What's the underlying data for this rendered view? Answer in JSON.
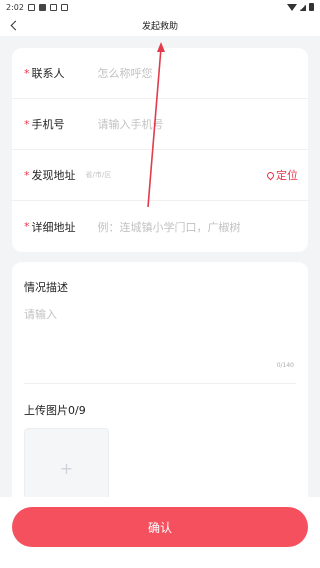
{
  "status_bar": {
    "time": "2:02"
  },
  "nav": {
    "title": "发起救助"
  },
  "form": {
    "contact": {
      "required_mark": "*",
      "label": "联系人",
      "placeholder": "怎么称呼您"
    },
    "phone": {
      "required_mark": "*",
      "label": "手机号",
      "placeholder": "请输入手机号"
    },
    "found_address": {
      "required_mark": "*",
      "label": "发现地址",
      "placeholder": "省/市/区",
      "locate_label": "定位"
    },
    "detail_address": {
      "required_mark": "*",
      "label": "详细地址",
      "placeholder": "例：连城镇小学门口，广椒树"
    }
  },
  "description": {
    "title": "情况描述",
    "placeholder": "请输入",
    "counter": "0/140"
  },
  "upload": {
    "title": "上传图片0/9",
    "plus": "+"
  },
  "confirm_label": "确认",
  "colors": {
    "accent": "#f4505e",
    "required": "#e8354a"
  }
}
